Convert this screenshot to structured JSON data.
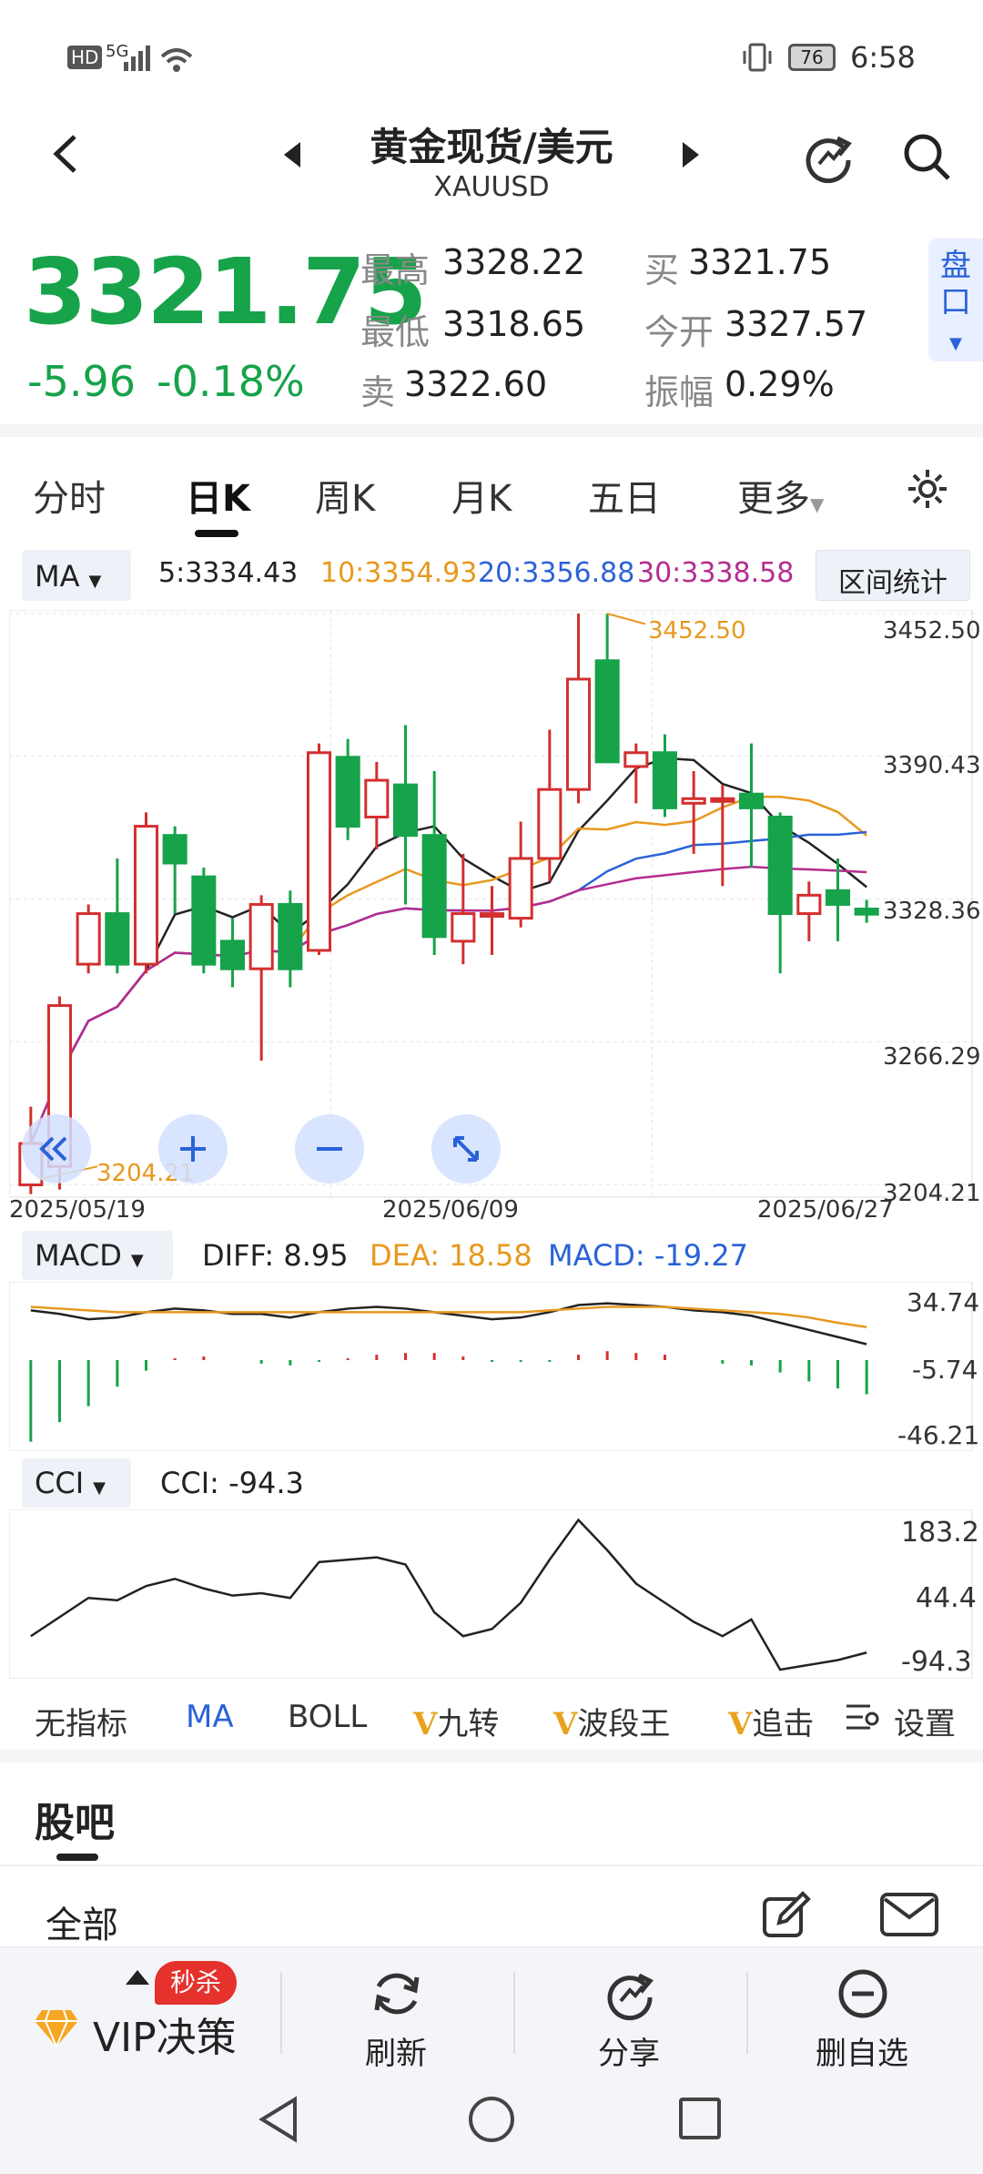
{
  "status": {
    "network": "HD",
    "signal": "5G",
    "battery": "76",
    "time": "6:58"
  },
  "header": {
    "title": "黄金现货/美元",
    "symbol": "XAUUSD"
  },
  "quote": {
    "price": "3321.75",
    "change": "-5.96",
    "change_pct": "-0.18%",
    "high_label": "最高",
    "high": "3328.22",
    "low_label": "最低",
    "low": "3318.65",
    "sell_label": "卖",
    "sell": "3322.60",
    "buy_label": "买",
    "buy": "3321.75",
    "open_label": "今开",
    "open": "3327.57",
    "amp_label": "振幅",
    "amp": "0.29%",
    "pankou": "盘口"
  },
  "tabs": [
    "分时",
    "日K",
    "周K",
    "月K",
    "五日",
    "更多"
  ],
  "ma": {
    "selector": "MA",
    "ma5": "5:3334.43",
    "ma10": "10:3354.93",
    "ma20": "20:3356.88",
    "ma30": "30:3338.58",
    "range_stats": "区间统计"
  },
  "main_chart": {
    "y_ticks": [
      "3452.50",
      "3390.43",
      "3328.36",
      "3266.29",
      "3204.21"
    ],
    "high_label": "3452.50",
    "low_label": "3204.21",
    "dates": [
      "2025/05/19",
      "2025/06/09",
      "2025/06/27"
    ]
  },
  "macd": {
    "selector": "MACD",
    "diff": "DIFF: 8.95",
    "dea": "DEA: 18.58",
    "macd": "MACD: -19.27",
    "ticks": [
      "34.74",
      "-5.74",
      "-46.21"
    ]
  },
  "cci": {
    "selector": "CCI",
    "value": "CCI: -94.3",
    "ticks": [
      "183.2",
      "44.4",
      "-94.3"
    ]
  },
  "indicator_tabs": [
    "无指标",
    "MA",
    "BOLL",
    "九转",
    "波段王",
    "追击",
    "设置"
  ],
  "forum": {
    "title": "股吧",
    "filter": "全部"
  },
  "bottom_nav": {
    "vip": "VIP决策",
    "flash": "秒杀",
    "refresh": "刷新",
    "share": "分享",
    "remove": "删自选"
  },
  "colors": {
    "up": "#d32f2f",
    "down": "#16a34a",
    "ma5": "#222222",
    "ma10": "#e8981e",
    "ma20": "#2a62d8",
    "ma30": "#b52c8f"
  },
  "chart_data": {
    "type": "candlestick",
    "ylim": [
      3204.21,
      3452.5
    ],
    "candles": [
      {
        "o": 3204,
        "h": 3238,
        "l": 3200,
        "c": 3222
      },
      {
        "o": 3212,
        "h": 3286,
        "l": 3202,
        "c": 3282
      },
      {
        "o": 3300,
        "h": 3326,
        "l": 3296,
        "c": 3322
      },
      {
        "o": 3322,
        "h": 3346,
        "l": 3296,
        "c": 3300
      },
      {
        "o": 3300,
        "h": 3366,
        "l": 3296,
        "c": 3360
      },
      {
        "o": 3356,
        "h": 3360,
        "l": 3322,
        "c": 3344
      },
      {
        "o": 3338,
        "h": 3342,
        "l": 3296,
        "c": 3300
      },
      {
        "o": 3310,
        "h": 3320,
        "l": 3290,
        "c": 3298
      },
      {
        "o": 3298,
        "h": 3330,
        "l": 3258,
        "c": 3326
      },
      {
        "o": 3326,
        "h": 3332,
        "l": 3290,
        "c": 3298
      },
      {
        "o": 3306,
        "h": 3396,
        "l": 3304,
        "c": 3392
      },
      {
        "o": 3390,
        "h": 3398,
        "l": 3354,
        "c": 3360
      },
      {
        "o": 3364,
        "h": 3388,
        "l": 3350,
        "c": 3380
      },
      {
        "o": 3378,
        "h": 3404,
        "l": 3326,
        "c": 3356
      },
      {
        "o": 3356,
        "h": 3384,
        "l": 3304,
        "c": 3312
      },
      {
        "o": 3310,
        "h": 3348,
        "l": 3300,
        "c": 3322
      },
      {
        "o": 3322,
        "h": 3334,
        "l": 3304,
        "c": 3322
      },
      {
        "o": 3320,
        "h": 3362,
        "l": 3316,
        "c": 3346
      },
      {
        "o": 3346,
        "h": 3402,
        "l": 3336,
        "c": 3376
      },
      {
        "o": 3376,
        "h": 3452.5,
        "l": 3370,
        "c": 3424
      },
      {
        "o": 3432,
        "h": 3452.5,
        "l": 3388,
        "c": 3388
      },
      {
        "o": 3386,
        "h": 3396,
        "l": 3370,
        "c": 3392
      },
      {
        "o": 3392,
        "h": 3400,
        "l": 3364,
        "c": 3368
      },
      {
        "o": 3370,
        "h": 3384,
        "l": 3348,
        "c": 3372
      },
      {
        "o": 3372,
        "h": 3378,
        "l": 3334,
        "c": 3372
      },
      {
        "o": 3374,
        "h": 3396,
        "l": 3342,
        "c": 3368
      },
      {
        "o": 3364,
        "h": 3366,
        "l": 3296,
        "c": 3322
      },
      {
        "o": 3322,
        "h": 3336,
        "l": 3310,
        "c": 3330
      },
      {
        "o": 3332,
        "h": 3346,
        "l": 3310,
        "c": 3326
      },
      {
        "o": 3324,
        "h": 3328,
        "l": 3318,
        "c": 3321.75
      }
    ],
    "macd_hist": [
      -46,
      -35,
      -26,
      -15,
      -6,
      1,
      2,
      0,
      -2,
      -3,
      -1,
      1,
      3,
      4,
      4,
      2,
      -1,
      -1,
      -1,
      3,
      5,
      4,
      3,
      0,
      -2,
      -3,
      -7,
      -12,
      -16,
      -19.27
    ],
    "diff": [
      28,
      26,
      23,
      24,
      27,
      29,
      28,
      26,
      26,
      24,
      27,
      29,
      30,
      29,
      27,
      25,
      23,
      24,
      27,
      31,
      32,
      31,
      30,
      28,
      27,
      25,
      21,
      17,
      13,
      8.95
    ],
    "dea": [
      30,
      29,
      28,
      27,
      27,
      27,
      27,
      27,
      27,
      27,
      27,
      27,
      27,
      27,
      27,
      27,
      27,
      27,
      28,
      29,
      30,
      30,
      30,
      29,
      28,
      27,
      26,
      24,
      21,
      18.58
    ],
    "cci": [
      -60,
      -20,
      20,
      15,
      45,
      60,
      40,
      25,
      30,
      20,
      95,
      100,
      105,
      90,
      -10,
      -60,
      -45,
      10,
      100,
      183.2,
      120,
      50,
      10,
      -30,
      -60,
      -25,
      -130,
      -120,
      -110,
      -94.3
    ]
  }
}
